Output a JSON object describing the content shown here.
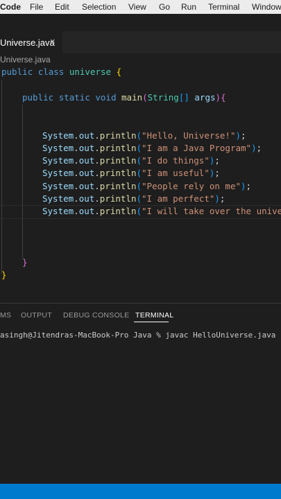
{
  "menubar": {
    "app": "Code",
    "items": [
      "File",
      "Edit",
      "Selection",
      "View",
      "Go",
      "Run",
      "Terminal",
      "Window"
    ]
  },
  "tab": {
    "label": "Universe.java",
    "close": "×"
  },
  "breadcrumb": "Universe.java",
  "code": {
    "line1": {
      "kw1": "public",
      "kw2": "class",
      "name": "universe",
      "brace": "{"
    },
    "line2": {
      "kw1": "public",
      "kw2": "static",
      "kw3": "void",
      "fn": "main",
      "paren_open": "(",
      "type": "String",
      "brackets": "[]",
      "arg": "args",
      "paren_close": ")",
      "brace": "{"
    },
    "println_lines": [
      "\"Hello, Universe!\"",
      "\"I am a Java Program\"",
      "\"I do things\"",
      "\"I am useful\"",
      "\"People rely on me\"",
      "\"I am perfect\"",
      "\"I will take over the univer"
    ],
    "system": "System",
    "out": "out",
    "println": "println",
    "close_inner": "}",
    "close_outer": "}"
  },
  "panel": {
    "tabs": [
      "MS",
      "OUTPUT",
      "DEBUG CONSOLE",
      "TERMINAL"
    ],
    "active_tab": "TERMINAL"
  },
  "terminal": {
    "line": "asingh@Jitendras-MacBook-Pro Java % javac HelloUniverse.java"
  },
  "colors": {
    "status_bar": "#007acc",
    "editor_bg": "#1e1e1e"
  }
}
